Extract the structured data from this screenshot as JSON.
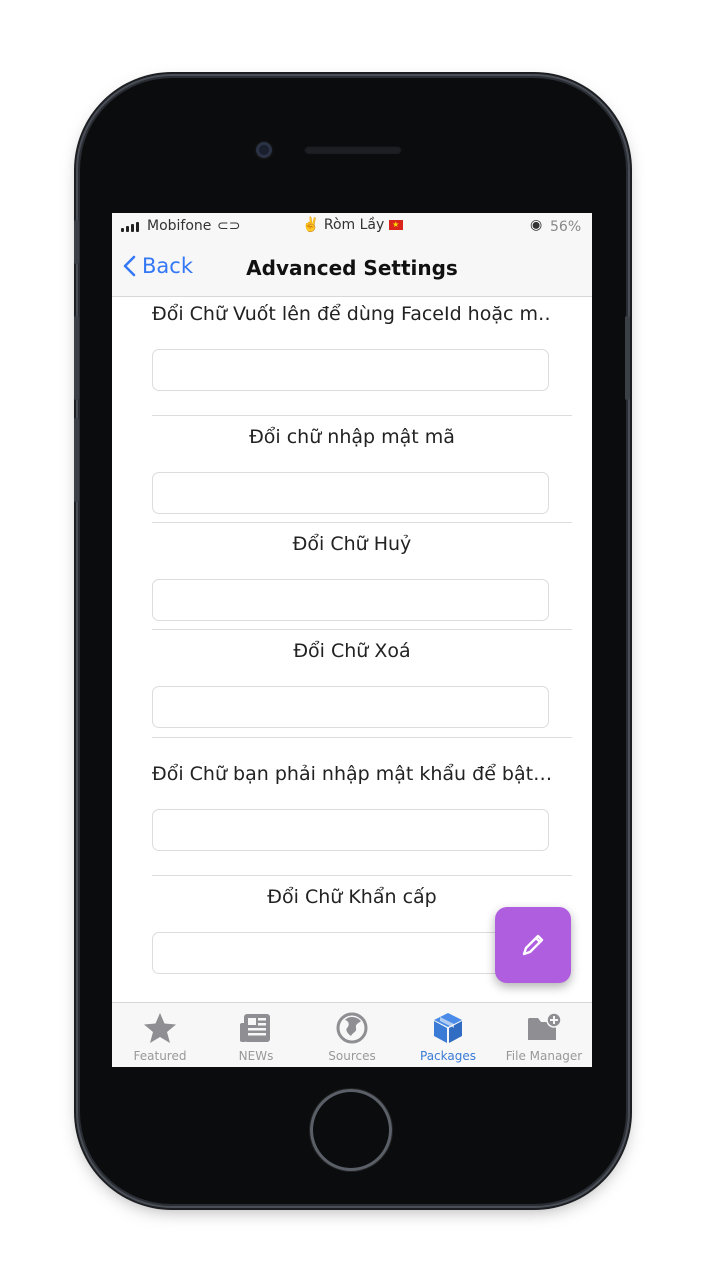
{
  "status": {
    "carrier": "Mobifone",
    "link_icon": "link-icon",
    "center_text": "✌️ Ròm Lầy",
    "flag": "★",
    "lock_icon": "rotation-lock-icon",
    "battery": "56%"
  },
  "nav": {
    "back_label": "Back",
    "title": "Advanced Settings"
  },
  "fields": [
    {
      "label": "Đổi Chữ Vuốt lên để dùng FaceId hoặc m…",
      "value": ""
    },
    {
      "label": "Đổi chữ nhập mật mã",
      "value": ""
    },
    {
      "label": "Đổi Chữ Huỷ",
      "value": ""
    },
    {
      "label": "Đổi Chữ Xoá",
      "value": ""
    },
    {
      "label": "Đổi Chữ bạn phải nhập mật khẩu để bật…",
      "value": ""
    },
    {
      "label": "Đổi Chữ Khẩn cấp",
      "value": ""
    }
  ],
  "tabs": [
    {
      "label": "Featured",
      "icon": "star-icon",
      "active": false
    },
    {
      "label": "NEWs",
      "icon": "newspaper-icon",
      "active": false
    },
    {
      "label": "Sources",
      "icon": "globe-icon",
      "active": false
    },
    {
      "label": "Packages",
      "icon": "package-icon",
      "active": true
    },
    {
      "label": "File Manager",
      "icon": "folder-plus-icon",
      "active": false
    }
  ],
  "colors": {
    "accent": "#3478f6",
    "fab": "#b05ee0",
    "active_tab": "#3a7bd5"
  }
}
